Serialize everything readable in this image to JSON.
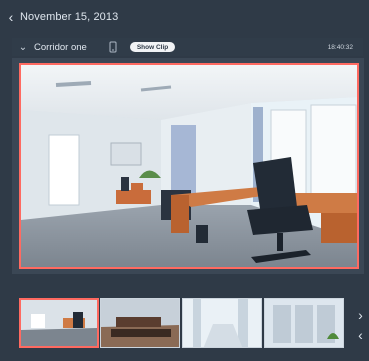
{
  "header": {
    "back_icon": "chevron-left-icon",
    "date": "November 15, 2013"
  },
  "camera": {
    "name": "Corridor one",
    "chevron_icon": "chevron-down-icon",
    "device_icon": "phone-icon",
    "show_clip_label": "Show Clip",
    "time": "18:40:32"
  },
  "viewer": {
    "description": "Office camera view"
  },
  "thumbnails": {
    "items": [
      {
        "name": "thumbnail-1",
        "selected": true
      },
      {
        "name": "thumbnail-2",
        "selected": false
      },
      {
        "name": "thumbnail-3",
        "selected": false
      },
      {
        "name": "thumbnail-4",
        "selected": false
      }
    ],
    "next_icon": "chevron-right-icon",
    "prev_icon": "chevron-left-icon"
  },
  "colors": {
    "background": "#2f3a47",
    "accent": "#ff6a61",
    "panel": "#3b4755"
  }
}
